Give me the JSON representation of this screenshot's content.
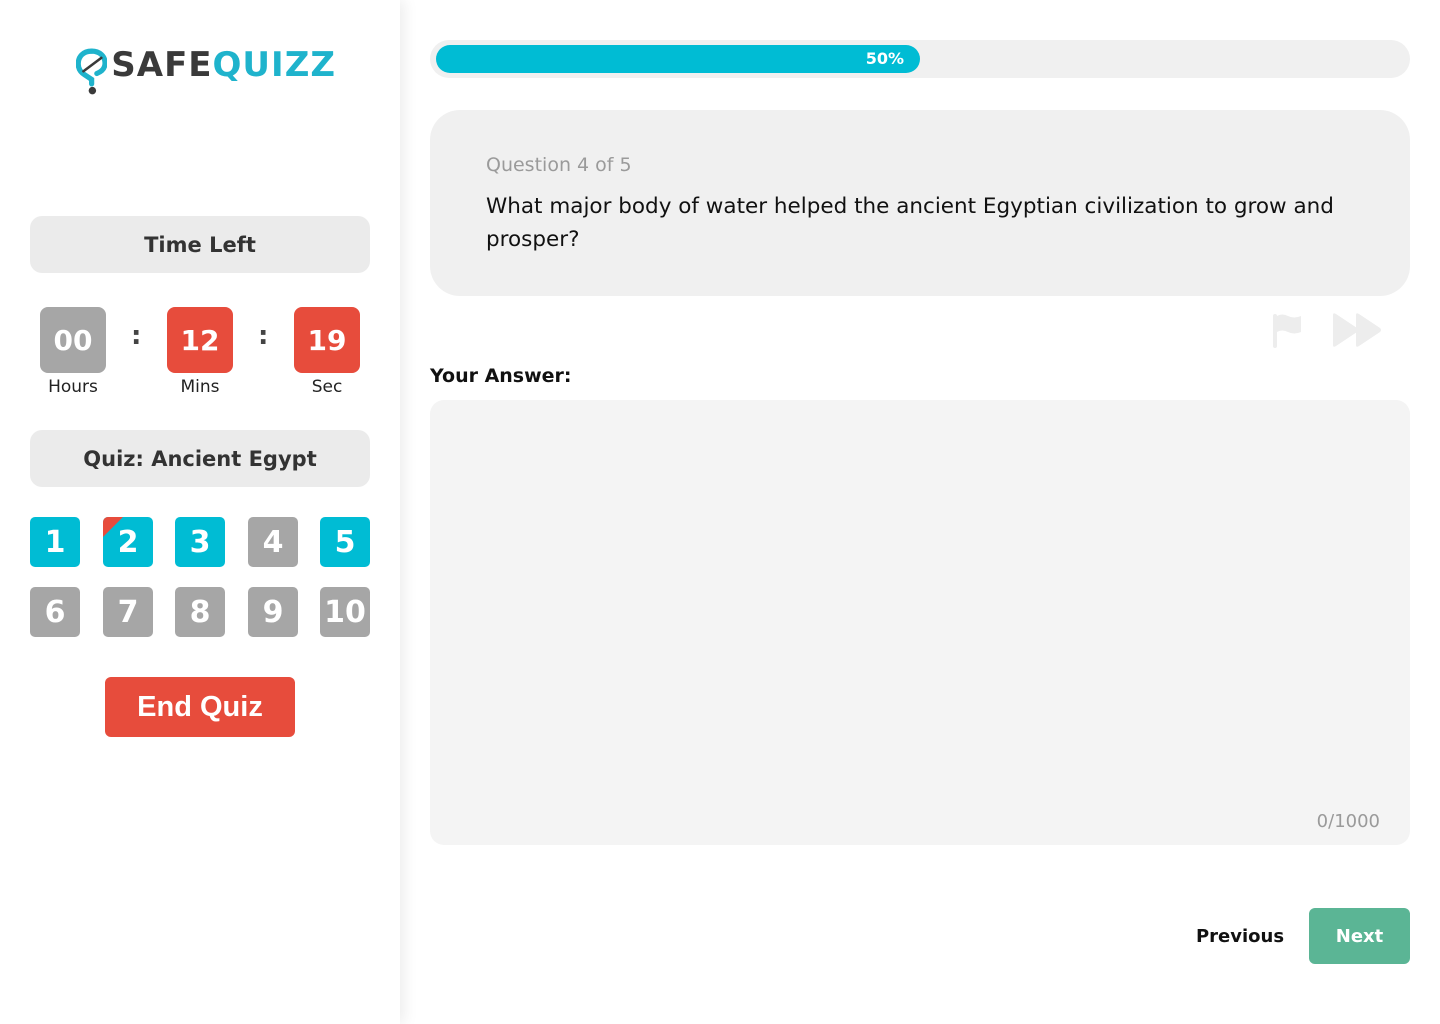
{
  "brand": {
    "logo_part1": "SAFE",
    "logo_part2": "QUIZZ"
  },
  "sidebar": {
    "time_left_label": "Time Left",
    "timer": {
      "hours": "00",
      "hours_label": "Hours",
      "mins": "12",
      "mins_label": "Mins",
      "sec": "19",
      "sec_label": "Sec",
      "separator": ":"
    },
    "quiz_title": "Quiz: Ancient Egypt",
    "questions": [
      {
        "label": "1",
        "state": "answered",
        "flagged": false
      },
      {
        "label": "2",
        "state": "answered",
        "flagged": true
      },
      {
        "label": "3",
        "state": "answered",
        "flagged": false
      },
      {
        "label": "4",
        "state": "unanswered",
        "flagged": false
      },
      {
        "label": "5",
        "state": "answered",
        "flagged": false
      },
      {
        "label": "6",
        "state": "unanswered",
        "flagged": false
      },
      {
        "label": "7",
        "state": "unanswered",
        "flagged": false
      },
      {
        "label": "8",
        "state": "unanswered",
        "flagged": false
      },
      {
        "label": "9",
        "state": "unanswered",
        "flagged": false
      },
      {
        "label": "10",
        "state": "unanswered",
        "flagged": false
      }
    ],
    "end_quiz_label": "End Quiz"
  },
  "progress": {
    "value": 0.5,
    "label": "50%"
  },
  "question": {
    "counter": "Question 4 of 5",
    "text": "What major body of water helped the ancient Egyptian civilization to grow and prosper?"
  },
  "icons": {
    "flag": "flag-icon",
    "skip": "fast-forward-icon"
  },
  "answer": {
    "label": "Your Answer:",
    "value": "",
    "char_count": "0/1000"
  },
  "nav": {
    "previous_label": "Previous",
    "next_label": "Next"
  },
  "colors": {
    "accent": "#00bcd4",
    "danger": "#e74c3c",
    "inactive": "#a6a6a6",
    "next_button": "#5bb595",
    "logo_dark": "#3a3a3a",
    "logo_accent": "#1fb3cc"
  }
}
